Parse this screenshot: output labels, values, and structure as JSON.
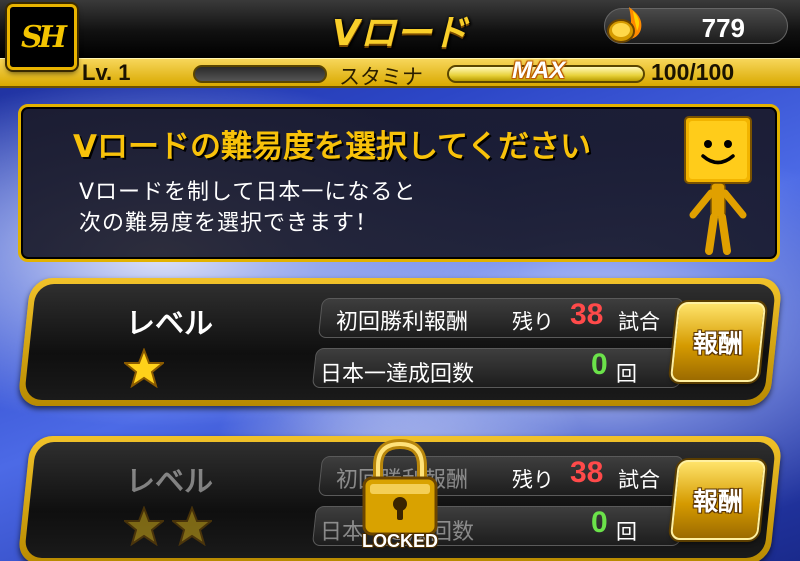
{
  "header": {
    "logo_text": "SH",
    "title": "Vロード",
    "coins": "779",
    "coin_icon": "flaming-coin-icon"
  },
  "status": {
    "level": "Lv. 1",
    "stamina_label": "スタミナ",
    "stamina_state": "MAX",
    "stamina_value": "100/100",
    "stamina_fill": 1.0
  },
  "info": {
    "heading": "Vロードの難易度を選択してください",
    "line1": "Vロードを制して日本一になると",
    "line2": "次の難易度を選択できます！",
    "mascot_icon": "yellow-box-mascot-icon"
  },
  "levels": [
    {
      "label": "レベル",
      "stars": 1,
      "first_win_label": "初回勝利報酬",
      "remaining_label": "残り",
      "remaining_count": "38",
      "games_unit": "試合",
      "champion_label": "日本一達成回数",
      "champion_count": "0",
      "count_unit": "回",
      "reward_label": "報酬",
      "locked": false
    },
    {
      "label": "レベル",
      "stars": 2,
      "first_win_label": "初回勝利報酬",
      "remaining_label": "残り",
      "remaining_count": "38",
      "games_unit": "試合",
      "champion_label": "日本一達成回数",
      "champion_count": "0",
      "count_unit": "回",
      "reward_label": "報酬",
      "locked": true,
      "locked_label": "LOCKED"
    }
  ],
  "colors": {
    "accent_gold": "#e2b200",
    "remaining_red": "#ff4a4a",
    "count_green": "#6be24a"
  }
}
